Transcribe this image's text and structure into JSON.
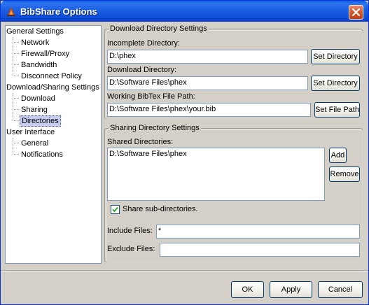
{
  "window": {
    "title": "BibShare Options"
  },
  "tree": {
    "nodes": [
      {
        "label": "General Settings",
        "level": 0
      },
      {
        "label": "Network",
        "level": 1
      },
      {
        "label": "Firewall/Proxy",
        "level": 1
      },
      {
        "label": "Bandwidth",
        "level": 1
      },
      {
        "label": "Disconnect Policy",
        "level": 1
      },
      {
        "label": "Download/Sharing Settings",
        "level": 0
      },
      {
        "label": "Download",
        "level": 1
      },
      {
        "label": "Sharing",
        "level": 1
      },
      {
        "label": "Directories",
        "level": 1,
        "selected": true
      },
      {
        "label": "User Interface",
        "level": 0
      },
      {
        "label": "General",
        "level": 1
      },
      {
        "label": "Notifications",
        "level": 1
      }
    ]
  },
  "download_group": {
    "legend": "Download Directory Settings",
    "incomplete_label": "Incomplete Directory:",
    "incomplete_value": "D:\\phex",
    "download_label": "Download Directory:",
    "download_value": "D:\\Software Files\\phex",
    "bibtex_label": "Working BibTex File Path:",
    "bibtex_value": "D:\\Software Files\\phex\\your.bib",
    "set_directory_label": "Set Directory",
    "set_file_path_label": "Set File Path"
  },
  "sharing_group": {
    "legend": "Sharing Directory Settings",
    "shared_label": "Shared Directories:",
    "shared_items": [
      "D:\\Software Files\\phex"
    ],
    "add_label": "Add",
    "remove_label": "Remove",
    "subdirs_label": "Share sub-directories.",
    "subdirs_checked": true,
    "include_label": "Include Files:",
    "include_value": "*",
    "exclude_label": "Exclude Files:",
    "exclude_value": ""
  },
  "footer": {
    "ok_label": "OK",
    "apply_label": "Apply",
    "cancel_label": "Cancel"
  },
  "colors": {
    "titlebar": "#0a5ae3",
    "dialog_bg": "#d4d0c8",
    "selection": "#c5ccee",
    "close_button": "#d2522a"
  },
  "icons": {
    "app": "bibshare-app-icon",
    "close": "close-icon",
    "check": "checkmark-icon"
  }
}
